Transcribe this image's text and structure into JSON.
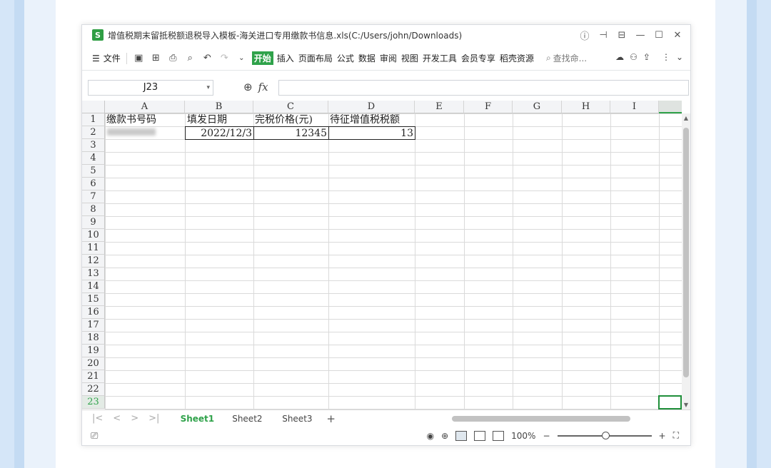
{
  "window": {
    "app_icon": "S",
    "title": "增值税期末留抵税额退税导入模板-海关进口专用缴款书信息.xls(C:/Users/john/Downloads)"
  },
  "toolbar": {
    "menu_label": "文件",
    "tabs": [
      "开始",
      "插入",
      "页面布局",
      "公式",
      "数据",
      "审阅",
      "视图",
      "开发工具",
      "会员专享",
      "稻壳资源"
    ],
    "active_tab": "开始",
    "search_placeholder": "查找命..."
  },
  "formula_bar": {
    "name_box": "J23",
    "fx_label": "fx",
    "value": ""
  },
  "columns": [
    "A",
    "B",
    "C",
    "D",
    "E",
    "F",
    "G",
    "H",
    "I"
  ],
  "rows": [
    "1",
    "2",
    "3",
    "4",
    "5",
    "6",
    "7",
    "8",
    "9",
    "10",
    "11",
    "12",
    "13",
    "14",
    "15",
    "16",
    "17",
    "18",
    "19",
    "20",
    "21",
    "22",
    "23"
  ],
  "selected_row": "23",
  "cells": {
    "A1": "缴款书号码",
    "B1": "填发日期",
    "C1": "完税价格(元)",
    "D1": "待征增值税税额",
    "B2": "2022/12/3",
    "C2": "12345",
    "D2": "13"
  },
  "sheets": [
    "Sheet1",
    "Sheet2",
    "Sheet3"
  ],
  "active_sheet": "Sheet1",
  "status": {
    "zoom": "100%"
  }
}
